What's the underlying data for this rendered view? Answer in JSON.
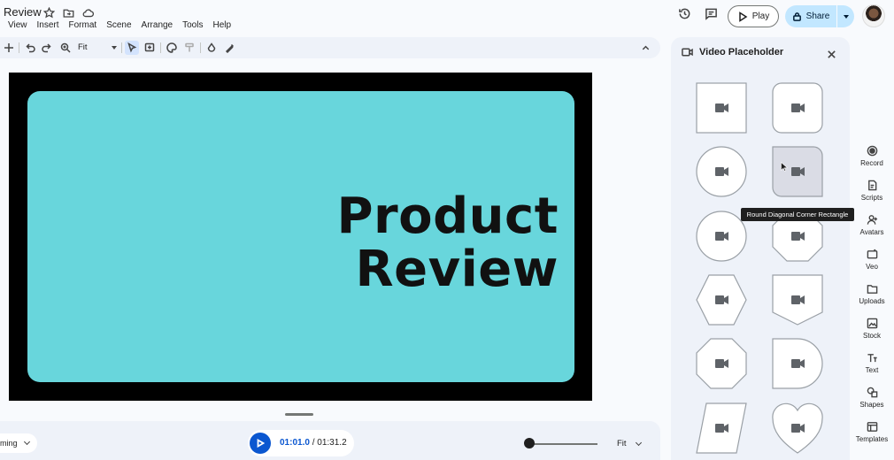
{
  "doc": {
    "title": "Review",
    "menu": [
      "View",
      "Insert",
      "Format",
      "Scene",
      "Arrange",
      "Tools",
      "Help"
    ]
  },
  "header": {
    "play_label": "Play",
    "share_label": "Share"
  },
  "toolbar": {
    "zoom_value": "Fit"
  },
  "slide": {
    "title_line1": "Product",
    "title_line2": "Review",
    "background": "#68d6dc"
  },
  "bottom_bar": {
    "timing_label": "ming",
    "current_time": "01:01.0",
    "separator": "/",
    "total_time": "01:31.2",
    "zoom_label": "Fit"
  },
  "panel": {
    "title": "Video Placeholder",
    "tooltip": "Round Diagonal Corner Rectangle",
    "shapes": [
      "rectangle",
      "rounded-rectangle",
      "circle",
      "round-diagonal-corner-rectangle",
      "circle",
      "octagon",
      "hexagon",
      "pentagon-banner",
      "octagon",
      "d-shape",
      "parallelogram",
      "heart"
    ]
  },
  "rail": {
    "items": [
      "Record",
      "Scripts",
      "Avatars",
      "Veo",
      "Uploads",
      "Stock",
      "Text",
      "Shapes",
      "Templates"
    ]
  },
  "colors": {
    "accent": "#0b57d0",
    "share_bg": "#c2e7ff"
  }
}
